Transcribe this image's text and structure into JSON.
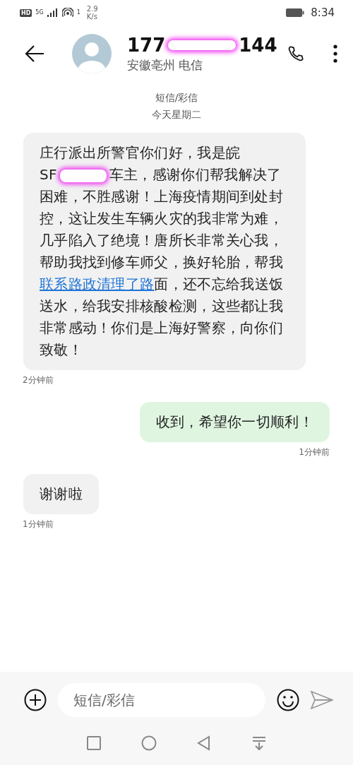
{
  "status_bar": {
    "hd_badge": "HD",
    "network": "5G",
    "wifi_label": "1",
    "speed_value": "2.9",
    "speed_unit": "K/s",
    "time": "8:34"
  },
  "header": {
    "number_start": "177",
    "number_end": "144",
    "location": "安徽亳州 电信"
  },
  "thread": {
    "channel": "短信/彩信",
    "day": "今天星期二"
  },
  "messages": [
    {
      "kind": "incoming",
      "segments": [
        {
          "kind": "text",
          "text": "庄行派出所警官你们好，我是皖"
        },
        {
          "kind": "redacted_plate",
          "text": "SF"
        },
        {
          "kind": "text",
          "text": "车主，感谢你们帮我解决了困难，不胜感谢！上海疫情期间到处封控，这让发生车辆火灾的我非常为难，几乎陷入了绝境！唐所长非常关心我，帮助我找到修车师父，换好轮胎，帮我"
        },
        {
          "kind": "link",
          "text": "联系路政清理了路"
        },
        {
          "kind": "text",
          "text": "面，还不忘给我送饭送水，给我安排核酸检测，这些都让我非常感动！你们是上海好警察，向你们致敬！"
        }
      ],
      "time": "2分钟前"
    },
    {
      "kind": "outgoing",
      "segments": [
        {
          "kind": "text",
          "text": "收到，希望你一切顺利！"
        }
      ],
      "time": "1分钟前"
    },
    {
      "kind": "incoming",
      "segments": [
        {
          "kind": "text",
          "text": "谢谢啦"
        }
      ],
      "time": "1分钟前"
    }
  ],
  "composer": {
    "placeholder": "短信/彩信"
  }
}
